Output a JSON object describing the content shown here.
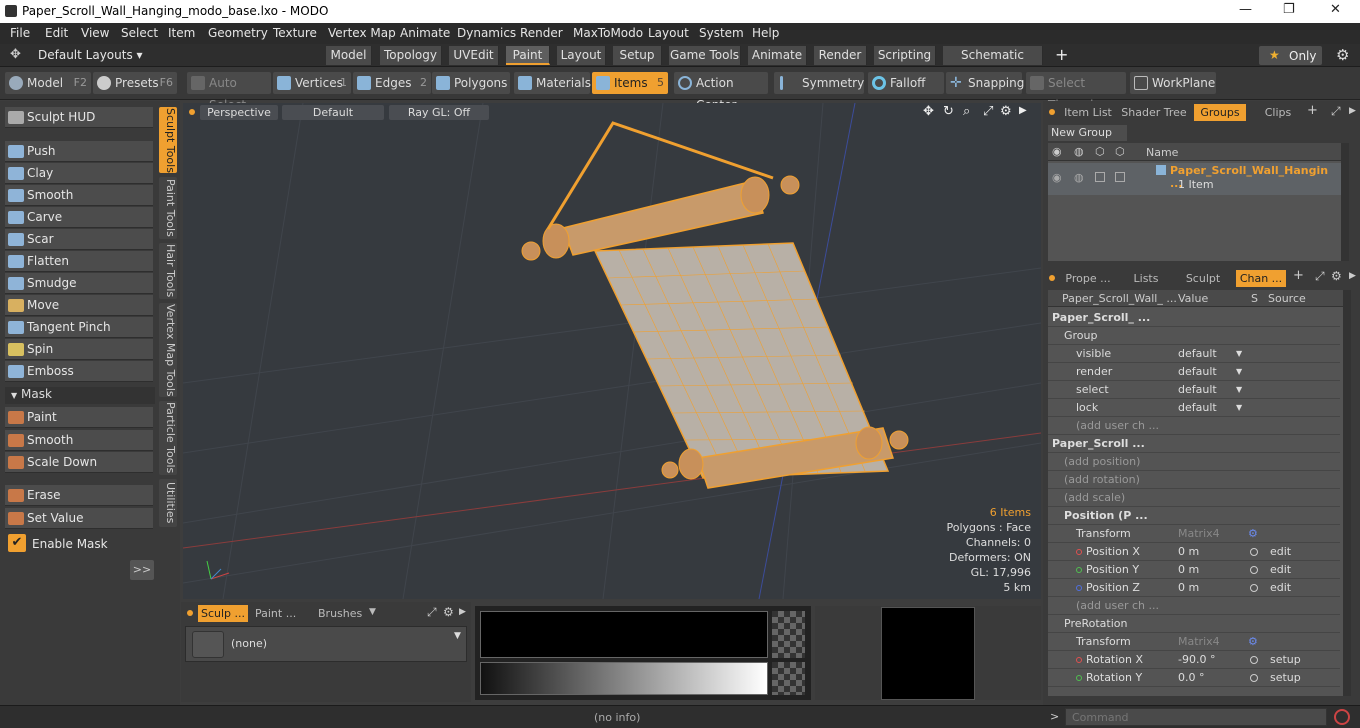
{
  "window": {
    "title": "Paper_Scroll_Wall_Hanging_modo_base.lxo - MODO",
    "minimize": "—",
    "maximize": "❐",
    "close": "✕"
  },
  "menu": [
    "File",
    "Edit",
    "View",
    "Select",
    "Item",
    "Geometry",
    "Texture",
    "Vertex Map",
    "Animate",
    "Dynamics",
    "Render",
    "MaxToModo",
    "Layout",
    "System",
    "Help"
  ],
  "layoutbar": {
    "layouts_label": "Default Layouts ▾",
    "tabs": [
      "Model",
      "Topology",
      "UVEdit",
      "Paint",
      "Layout",
      "Setup",
      "Game Tools",
      "Animate",
      "Render",
      "Scripting",
      "Schematic Fusion"
    ],
    "active_tab": "Paint",
    "add": "+",
    "only_label": "Only",
    "star": "★"
  },
  "toolbar": {
    "model": "Model",
    "model_key": "F2",
    "presets": "Presets",
    "presets_key": "F6",
    "auto_select": "Auto Select",
    "vertices": "Vertices",
    "vertices_key": "1",
    "edges": "Edges",
    "edges_key": "2",
    "polygons": "Polygons",
    "materials": "Materials",
    "items": "Items",
    "items_key": "5",
    "action_center": "Action Center",
    "symmetry": "Symmetry",
    "falloff": "Falloff",
    "snapping": "Snapping",
    "select_through": "Select Through",
    "workplane": "WorkPlane"
  },
  "left": {
    "sculpt_hud": "Sculpt HUD",
    "tools": [
      "Push",
      "Clay",
      "Smooth",
      "Carve",
      "Scar",
      "Flatten",
      "Smudge",
      "Move",
      "Tangent Pinch",
      "Spin",
      "Emboss"
    ],
    "mask_header": "Mask",
    "mask_tools": [
      "Paint",
      "Smooth",
      "Scale Down"
    ],
    "erase": "Erase",
    "set_value": "Set Value",
    "enable_mask": "Enable Mask",
    "expand": ">>",
    "vtabs": [
      "Sculpt Tools",
      "Paint Tools",
      "Hair Tools",
      "Vertex Map Tools",
      "Particle Tools",
      "Utilities"
    ]
  },
  "viewport": {
    "perspective": "Perspective",
    "default": "Default",
    "raygl": "Ray GL: Off",
    "info": {
      "items": "6 Items",
      "polygons": "Polygons : Face",
      "channels": "Channels: 0",
      "deformers": "Deformers: ON",
      "gl": "GL: 17,996",
      "scale": "5 km"
    }
  },
  "bottom": {
    "tabs": [
      "Sculp ...",
      "Paint ...",
      "Brushes"
    ],
    "brush_value": "(none)"
  },
  "right": {
    "top_tabs": [
      "Item List",
      "Shader Tree",
      "Groups",
      "Clips"
    ],
    "active_top": "Groups",
    "new_group": "New Group",
    "name_col": "Name",
    "group_name": "Paper_Scroll_Wall_Hangin ...",
    "group_count": "1 Item",
    "bottom_tabs": [
      "Prope ...",
      "Lists",
      "Sculpt",
      "Chan ..."
    ],
    "active_bottom": "Chan ...",
    "col_name": "Paper_Scroll_Wall_ ...",
    "col_value": "Value",
    "col_s": "S",
    "col_source": "Source",
    "rows": [
      {
        "name": "Paper_Scroll_ ...",
        "value": "",
        "source": ""
      },
      {
        "name": "Group",
        "value": "",
        "source": ""
      },
      {
        "name": "visible",
        "value": "default",
        "source": ""
      },
      {
        "name": "render",
        "value": "default",
        "source": ""
      },
      {
        "name": "select",
        "value": "default",
        "source": ""
      },
      {
        "name": "lock",
        "value": "default",
        "source": ""
      },
      {
        "name": "(add user ch ...",
        "value": "",
        "source": ""
      },
      {
        "name": "Paper_Scroll ...",
        "value": "",
        "source": ""
      },
      {
        "name": "(add position)",
        "value": "",
        "source": ""
      },
      {
        "name": "(add rotation)",
        "value": "",
        "source": ""
      },
      {
        "name": "(add scale)",
        "value": "",
        "source": ""
      },
      {
        "name": "Position (P ...",
        "value": "",
        "source": ""
      },
      {
        "name": "Transform",
        "value": "Matrix4",
        "source": ""
      },
      {
        "name": "Position X",
        "value": "0 m",
        "source": "edit"
      },
      {
        "name": "Position Y",
        "value": "0 m",
        "source": "edit"
      },
      {
        "name": "Position Z",
        "value": "0 m",
        "source": "edit"
      },
      {
        "name": "(add user ch ...",
        "value": "",
        "source": ""
      },
      {
        "name": "PreRotation",
        "value": "",
        "source": ""
      },
      {
        "name": "Transform",
        "value": "Matrix4",
        "source": ""
      },
      {
        "name": "Rotation X",
        "value": "-90.0 °",
        "source": "setup"
      },
      {
        "name": "Rotation Y",
        "value": "0.0 °",
        "source": "setup"
      }
    ]
  },
  "status": {
    "info": "(no info)",
    "command_placeholder": "Command"
  }
}
